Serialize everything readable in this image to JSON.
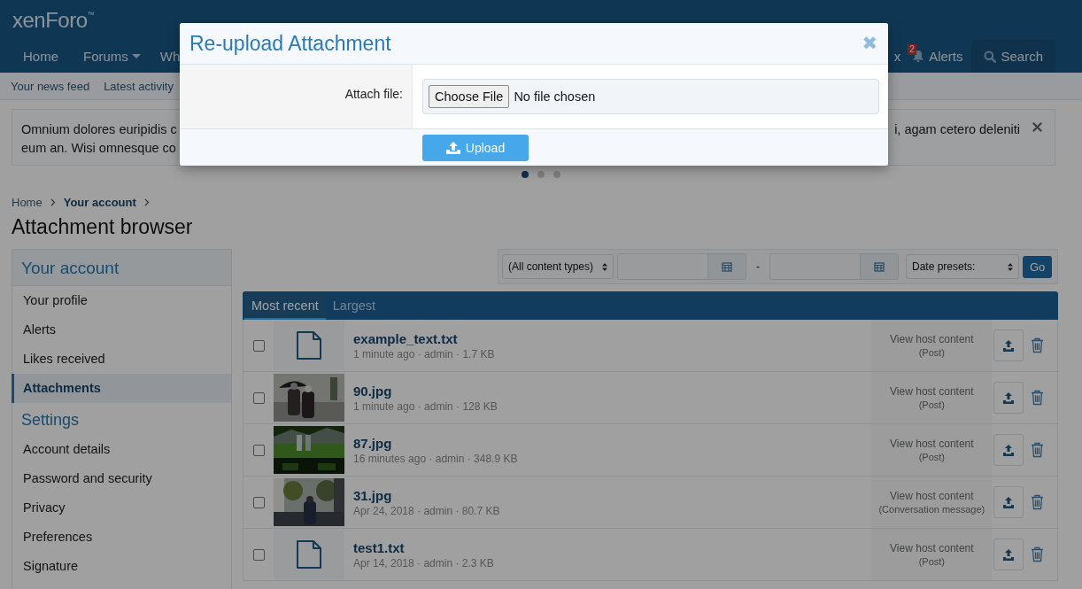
{
  "header": {
    "logo": "xenForo",
    "logo_mark": "™"
  },
  "nav_left": [
    {
      "label": "Home",
      "dropdown": false
    },
    {
      "label": "Forums",
      "dropdown": true
    },
    {
      "label": "Wh",
      "dropdown": false
    }
  ],
  "nav_right": [
    {
      "label": "x",
      "kind": "text"
    },
    {
      "label": "Alerts",
      "kind": "alerts",
      "badge": "2"
    },
    {
      "label": "Search",
      "kind": "search"
    }
  ],
  "subnav": [
    "Your news feed",
    "Latest activity"
  ],
  "notice": {
    "line_1_start": "Omnium dolores euripidis c",
    "line_1_end": "i, agam cetero deleniti",
    "line_2_start": "eum an. Wisi omnesque co"
  },
  "carousel_dots": [
    {
      "selected": true
    },
    {
      "selected": false
    },
    {
      "selected": false
    }
  ],
  "breadcrumb": [
    "Home",
    "Your account"
  ],
  "page_title": "Attachment browser",
  "sidebar": [
    {
      "title": "Your account",
      "items": [
        {
          "label": "Your profile",
          "selected": false
        },
        {
          "label": "Alerts",
          "selected": false
        },
        {
          "label": "Likes received",
          "selected": false
        },
        {
          "label": "Attachments",
          "selected": true
        }
      ]
    },
    {
      "title": "Settings",
      "items": [
        {
          "label": "Account details",
          "selected": false
        },
        {
          "label": "Password and security",
          "selected": false
        },
        {
          "label": "Privacy",
          "selected": false
        },
        {
          "label": "Preferences",
          "selected": false
        },
        {
          "label": "Signature",
          "selected": false
        }
      ]
    }
  ],
  "filters": {
    "content_type": "(All content types)",
    "separator": "-",
    "date_presets": "Date presets:",
    "go": "Go"
  },
  "tabs": [
    {
      "label": "Most recent",
      "selected": true
    },
    {
      "label": "Largest",
      "selected": false
    }
  ],
  "rows": [
    {
      "name": "example_text.txt",
      "meta": "1 minute ago · admin · 1.7 KB",
      "host": "View host content",
      "host_type": "(Post)",
      "kind": "file",
      "checked": false
    },
    {
      "name": "90.jpg",
      "meta": "1 minute ago · admin · 128 KB",
      "host": "View host content",
      "host_type": "(Post)",
      "kind": "picture",
      "checked": false
    },
    {
      "name": "87.jpg",
      "meta": "16 minutes ago · admin · 348.9 KB",
      "host": "View host content",
      "host_type": "(Post)",
      "kind": "picture",
      "checked": false
    },
    {
      "name": "31.jpg",
      "meta": "Apr 24, 2018 · admin · 80.7 KB",
      "host": "View host content",
      "host_type": "(Conversation message)",
      "kind": "picture",
      "checked": false
    },
    {
      "name": "test1.txt",
      "meta": "Apr 14, 2018 · admin · 2.3 KB",
      "host": "View host content",
      "host_type": "(Post)",
      "kind": "file",
      "checked": false
    }
  ],
  "dialog": {
    "title": "Re-upload Attachment",
    "close": "✖",
    "field_label": "Attach file:",
    "choose_button": "Choose File",
    "file_status": "No file chosen",
    "upload_button": "Upload"
  }
}
